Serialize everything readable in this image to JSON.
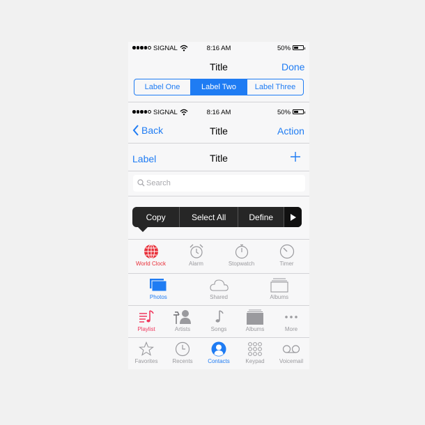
{
  "status_bar": {
    "carrier": "SIGNAL",
    "time": "8:16 AM",
    "battery": "50%",
    "battery_level": 0.5
  },
  "nav1": {
    "title": "Title",
    "done": "Done"
  },
  "segmented": {
    "items": [
      "Label One",
      "Label Two",
      "Label Three"
    ],
    "selected": 1
  },
  "nav2": {
    "back": "Back",
    "title": "Title",
    "action": "Action"
  },
  "nav3": {
    "label": "Label",
    "title": "Title",
    "plus_icon": "plus-icon"
  },
  "search": {
    "placeholder": "Search"
  },
  "edit_menu": {
    "items": [
      "Copy",
      "Select All",
      "Define"
    ],
    "more_icon": "play-arrow-icon"
  },
  "clock_tabs": [
    {
      "label": "World Clock",
      "icon": "globe-icon",
      "active": true
    },
    {
      "label": "Alarm",
      "icon": "alarm-icon",
      "active": false
    },
    {
      "label": "Stopwatch",
      "icon": "stopwatch-icon",
      "active": false
    },
    {
      "label": "Timer",
      "icon": "timer-icon",
      "active": false
    }
  ],
  "photo_tabs": [
    {
      "label": "Photos",
      "icon": "photos-icon",
      "active": true
    },
    {
      "label": "Shared",
      "icon": "cloud-icon",
      "active": false
    },
    {
      "label": "Albums",
      "icon": "albums-icon",
      "active": false
    }
  ],
  "music_tabs": [
    {
      "label": "Playlist",
      "icon": "playlist-icon",
      "active": true
    },
    {
      "label": "Artists",
      "icon": "artists-icon",
      "active": false
    },
    {
      "label": "Songs",
      "icon": "music-note-icon",
      "active": false
    },
    {
      "label": "Albums",
      "icon": "albums-stack-icon",
      "active": false
    },
    {
      "label": "More",
      "icon": "more-dots-icon",
      "active": false
    }
  ],
  "phone_tabs": [
    {
      "label": "Favorites",
      "icon": "star-icon",
      "active": false
    },
    {
      "label": "Recents",
      "icon": "clock-icon",
      "active": false
    },
    {
      "label": "Contacts",
      "icon": "contacts-icon",
      "active": true
    },
    {
      "label": "Keypad",
      "icon": "keypad-icon",
      "active": false
    },
    {
      "label": "Voicemail",
      "icon": "voicemail-icon",
      "active": false
    }
  ],
  "colors": {
    "accent": "#1f7cf3",
    "clock_active": "#e8303a",
    "music_active": "#f0365c",
    "inactive": "#9a9a9e",
    "menu_bg": "#262626"
  }
}
